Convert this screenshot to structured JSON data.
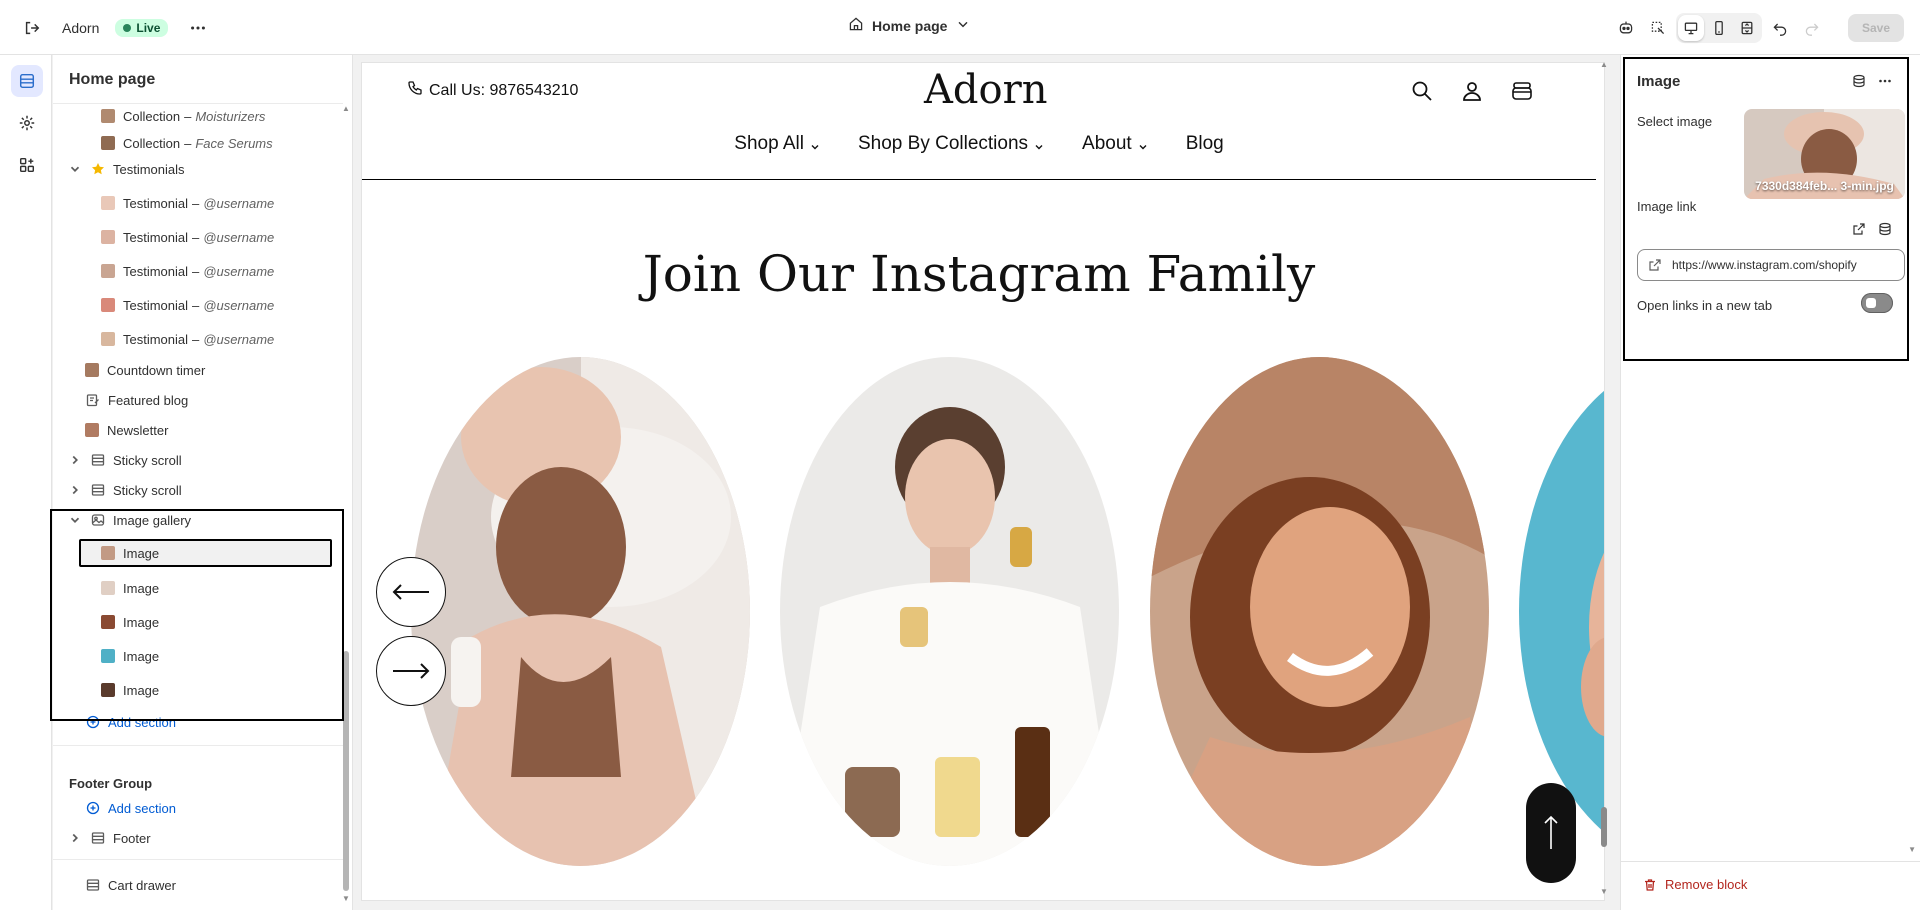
{
  "topbar": {
    "store_name": "Adorn",
    "status": "Live",
    "page_selector": "Home page",
    "save_label": "Save"
  },
  "sidebar": {
    "title": "Home page",
    "collections": [
      {
        "label": "Collection",
        "sub": "Moisturizers"
      },
      {
        "label": "Collection",
        "sub": "Face Serums"
      }
    ],
    "testimonials_label": "Testimonials",
    "testimonials": [
      {
        "label": "Testimonial",
        "sub": "@username"
      },
      {
        "label": "Testimonial",
        "sub": "@username"
      },
      {
        "label": "Testimonial",
        "sub": "@username"
      },
      {
        "label": "Testimonial",
        "sub": "@username"
      },
      {
        "label": "Testimonial",
        "sub": "@username"
      }
    ],
    "sections": [
      {
        "label": "Countdown timer"
      },
      {
        "label": "Featured blog"
      },
      {
        "label": "Newsletter"
      },
      {
        "label": "Sticky scroll"
      },
      {
        "label": "Sticky scroll"
      }
    ],
    "gallery_label": "Image gallery",
    "gallery_items": [
      "Image",
      "Image",
      "Image",
      "Image",
      "Image"
    ],
    "add_section": "Add section",
    "footer_group": "Footer Group",
    "footer_add_section": "Add section",
    "footer": "Footer",
    "cart_drawer": "Cart drawer"
  },
  "preview": {
    "phone": "Call Us: 9876543210",
    "logo": "Adorn",
    "nav": [
      "Shop All",
      "Shop By Collections",
      "About",
      "Blog"
    ],
    "section_title": "Join Our Instagram Family"
  },
  "panel": {
    "title": "Image",
    "select_image_label": "Select image",
    "image_filename": "7330d384feb... 3-min.jpg",
    "image_link_label": "Image link",
    "image_link_value": "https://www.instagram.com/shopify",
    "new_tab_label": "Open links in a new tab",
    "new_tab_enabled": false,
    "remove_label": "Remove block"
  },
  "colors": {
    "accent": "#005bd3",
    "live_badge_bg": "#cdfee1",
    "danger": "#b3261e"
  }
}
